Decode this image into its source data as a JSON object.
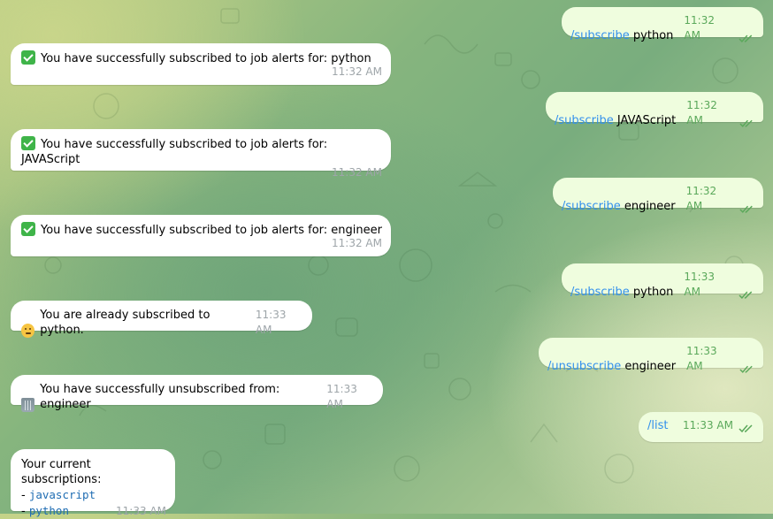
{
  "incoming": [
    {
      "text": "You have successfully subscribed to job alerts for: python",
      "time": "11:32 AM",
      "icon": "check-mark-emoji"
    },
    {
      "text": "You have successfully subscribed to job alerts for: JAVAScript",
      "time": "11:32 AM",
      "icon": "check-mark-emoji"
    },
    {
      "text": "You have successfully subscribed to job alerts for: engineer",
      "time": "11:32 AM",
      "icon": "check-mark-emoji"
    },
    {
      "text": "You are already subscribed to python.",
      "time": "11:33 AM",
      "icon": "thinking-face-emoji"
    },
    {
      "text": "You have successfully unsubscribed from: engineer",
      "time": "11:33 AM",
      "icon": "wastebasket-emoji"
    },
    {
      "title": "Your current subscriptions:",
      "items": [
        "javascript",
        "python"
      ],
      "time": "11:33 AM"
    }
  ],
  "outgoing": [
    {
      "command": "/subscribe",
      "arg": "python",
      "time": "11:32 AM"
    },
    {
      "command": "/subscribe",
      "arg": "JAVAScript",
      "time": "11:32 AM"
    },
    {
      "command": "/subscribe",
      "arg": "engineer",
      "time": "11:32 AM"
    },
    {
      "command": "/subscribe",
      "arg": "python",
      "time": "11:33 AM"
    },
    {
      "command": "/unsubscribe",
      "arg": "engineer",
      "time": "11:33 AM"
    },
    {
      "command": "/list",
      "arg": "",
      "time": "11:33 AM"
    }
  ],
  "colors": {
    "incoming_bubble": "#ffffff",
    "outgoing_bubble": "#effdde",
    "command_link": "#3390ec",
    "outgoing_time": "#5aa85a",
    "incoming_time": "#9ea5a9"
  }
}
